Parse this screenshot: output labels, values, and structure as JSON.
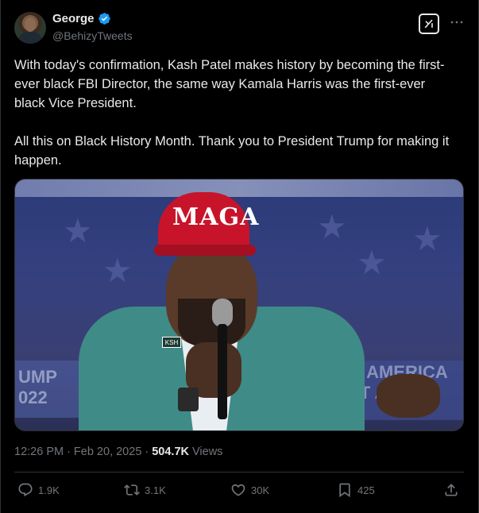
{
  "author": {
    "name": "George",
    "handle": "@BehizyTweets",
    "verified": true
  },
  "tweet": {
    "paragraph1": "With today's confirmation, Kash Patel makes history by becoming the first-ever black FBI Director, the same way Kamala Harris was the first-ever black Vice President.",
    "paragraph2": "All this on Black History Month. Thank you to President Trump for making it happen."
  },
  "media": {
    "cap_text": "MAGA",
    "pin_text": "KSH",
    "banner_left": "UMP\n022",
    "banner_right": "MAKE AMERICA\nGREAT AGAIN"
  },
  "meta": {
    "time": "12:26 PM",
    "separator": "·",
    "date": "Feb 20, 2025",
    "separator2": "·",
    "views_count": "504.7K",
    "views_label": "Views"
  },
  "actions": {
    "replies": "1.9K",
    "reposts": "3.1K",
    "likes": "30K",
    "bookmarks": "425"
  },
  "icons": {
    "verified": "verified-badge-icon",
    "grok": "grok-icon",
    "more": "more-icon",
    "reply": "reply-icon",
    "repost": "repost-icon",
    "like": "like-icon",
    "bookmark": "bookmark-icon",
    "share": "share-icon"
  },
  "colors": {
    "background": "#000000",
    "text": "#e7e9ea",
    "muted": "#71767b",
    "verified": "#1d9bf0"
  }
}
